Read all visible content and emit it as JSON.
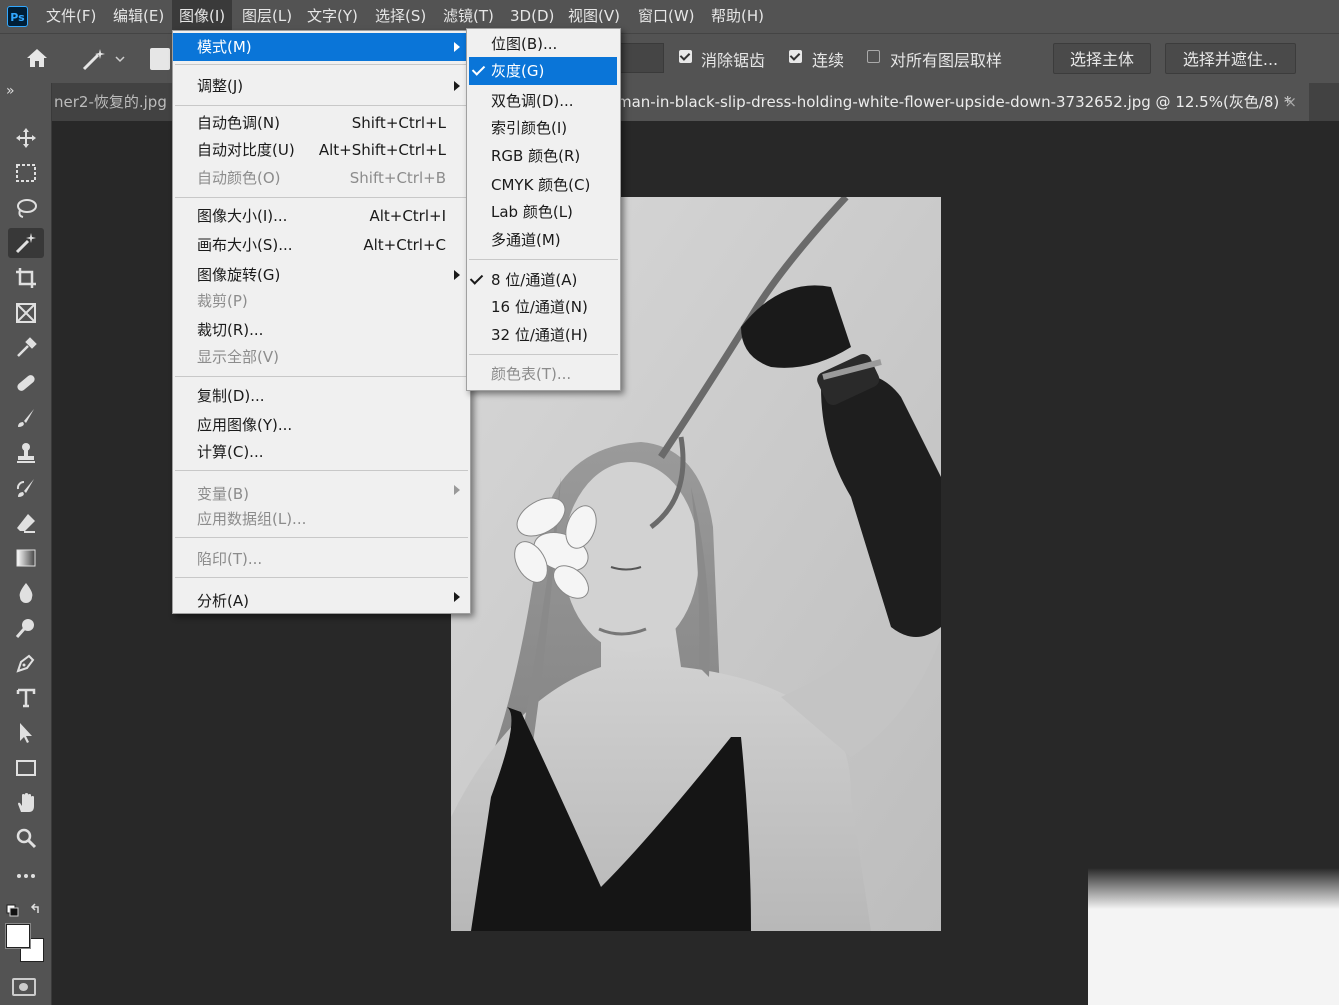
{
  "app": {
    "logo_text": "Ps"
  },
  "menubar": {
    "items": [
      "文件(F)",
      "编辑(E)",
      "图像(I)",
      "图层(L)",
      "文字(Y)",
      "选择(S)",
      "滤镜(T)",
      "3D(D)",
      "视图(V)",
      "窗口(W)",
      "帮助(H)"
    ],
    "active_index": 2
  },
  "options": {
    "anti_alias_label": "消除锯齿",
    "anti_alias_checked": true,
    "contiguous_label": "连续",
    "contiguous_checked": true,
    "sample_all_label": "对所有图层取样",
    "sample_all_checked": false,
    "select_subject_label": "选择主体",
    "select_mask_label": "选择并遮住..."
  },
  "tabs": {
    "inactive_tab": "ner2-恢复的.jpg",
    "active_tab": "man-in-black-slip-dress-holding-white-flower-upside-down-3732652.jpg @ 12.5%(灰色/8) *",
    "close_glyph": "×",
    "expand_glyph": "»"
  },
  "image_menu": {
    "items": [
      {
        "label": "模式(M)",
        "shortcut": "",
        "submenu": true,
        "disabled": false,
        "highlighted": true
      },
      {
        "label": "调整(J)",
        "shortcut": "",
        "submenu": true,
        "disabled": false
      },
      {
        "label": "自动色调(N)",
        "shortcut": "Shift+Ctrl+L",
        "disabled": false
      },
      {
        "label": "自动对比度(U)",
        "shortcut": "Alt+Shift+Ctrl+L",
        "disabled": false
      },
      {
        "label": "自动颜色(O)",
        "shortcut": "Shift+Ctrl+B",
        "disabled": true
      },
      {
        "label": "图像大小(I)...",
        "shortcut": "Alt+Ctrl+I",
        "disabled": false
      },
      {
        "label": "画布大小(S)...",
        "shortcut": "Alt+Ctrl+C",
        "disabled": false
      },
      {
        "label": "图像旋转(G)",
        "shortcut": "",
        "submenu": true,
        "disabled": false
      },
      {
        "label": "裁剪(P)",
        "shortcut": "",
        "disabled": true
      },
      {
        "label": "裁切(R)...",
        "shortcut": "",
        "disabled": false
      },
      {
        "label": "显示全部(V)",
        "shortcut": "",
        "disabled": true
      },
      {
        "label": "复制(D)...",
        "shortcut": "",
        "disabled": false
      },
      {
        "label": "应用图像(Y)...",
        "shortcut": "",
        "disabled": false
      },
      {
        "label": "计算(C)...",
        "shortcut": "",
        "disabled": false
      },
      {
        "label": "变量(B)",
        "shortcut": "",
        "submenu": true,
        "disabled": true
      },
      {
        "label": "应用数据组(L)...",
        "shortcut": "",
        "disabled": true
      },
      {
        "label": "陷印(T)...",
        "shortcut": "",
        "disabled": true
      },
      {
        "label": "分析(A)",
        "shortcut": "",
        "submenu": true,
        "disabled": false
      }
    ]
  },
  "mode_submenu": {
    "items": [
      {
        "label": "位图(B)...",
        "checked": false,
        "disabled": false
      },
      {
        "label": "灰度(G)",
        "checked": true,
        "disabled": false,
        "highlighted": true
      },
      {
        "label": "双色调(D)...",
        "checked": false,
        "disabled": false
      },
      {
        "label": "索引颜色(I)",
        "checked": false,
        "disabled": false
      },
      {
        "label": "RGB 颜色(R)",
        "checked": false,
        "disabled": false
      },
      {
        "label": "CMYK 颜色(C)",
        "checked": false,
        "disabled": false
      },
      {
        "label": "Lab 颜色(L)",
        "checked": false,
        "disabled": false
      },
      {
        "label": "多通道(M)",
        "checked": false,
        "disabled": false
      },
      {
        "label": "8 位/通道(A)",
        "checked": true,
        "disabled": false
      },
      {
        "label": "16 位/通道(N)",
        "checked": false,
        "disabled": false
      },
      {
        "label": "32 位/通道(H)",
        "checked": false,
        "disabled": false
      },
      {
        "label": "颜色表(T)...",
        "checked": false,
        "disabled": true
      }
    ]
  },
  "colors": {
    "menubar_bg": "#535353",
    "menu_bg": "#f0f0f0",
    "highlight": "#0a75d8",
    "canvas_bg": "#282828"
  },
  "toolbar_icons": [
    "move-icon",
    "marquee-icon",
    "lasso-icon",
    "magic-wand-icon",
    "crop-icon",
    "frame-icon",
    "eyedropper-icon",
    "healing-brush-icon",
    "brush-icon",
    "stamp-icon",
    "history-brush-icon",
    "eraser-icon",
    "gradient-icon",
    "blur-icon",
    "dodge-icon",
    "pen-icon",
    "type-icon",
    "path-select-icon",
    "rectangle-icon",
    "hand-icon",
    "zoom-icon",
    "more-tools-icon",
    "swap-colors-icon",
    "color-swatches-icon",
    "quick-mask-icon"
  ]
}
